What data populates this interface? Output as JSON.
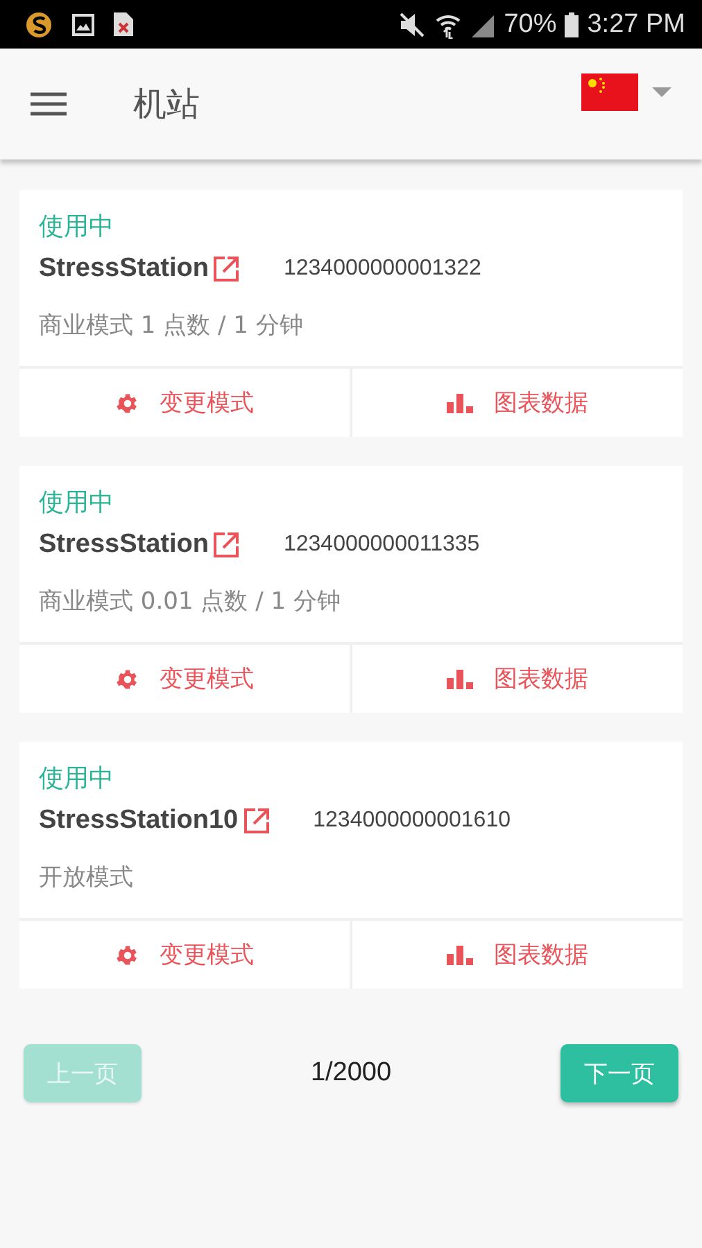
{
  "status_bar": {
    "battery": "70%",
    "time": "3:27 PM"
  },
  "app_bar": {
    "title": "机站"
  },
  "stations": [
    {
      "status": "使用中",
      "name": "StressStation",
      "id": "1234000000001322",
      "mode": "商业模式 1 点数 / 1 分钟",
      "actions": [
        {
          "kind": "settings",
          "label": "变更模式"
        },
        {
          "kind": "chart",
          "label": "图表数据"
        }
      ]
    },
    {
      "status": "使用中",
      "name": "StressStation",
      "id": "1234000000011335",
      "mode": "商业模式 0.01 点数 / 1 分钟",
      "actions": [
        {
          "kind": "settings",
          "label": "变更模式"
        },
        {
          "kind": "chart",
          "label": "图表数据"
        }
      ]
    },
    {
      "status": "使用中",
      "name": "StressStation10",
      "id": "1234000000001610",
      "mode": "开放模式",
      "actions": [
        {
          "kind": "settings",
          "label": "变更模式"
        },
        {
          "kind": "chart",
          "label": "图表数据"
        }
      ]
    }
  ],
  "pagination": {
    "prev": {
      "label": "上一页",
      "disabled": true
    },
    "page": "1/2000",
    "next": {
      "label": "下一页",
      "disabled": false
    }
  }
}
